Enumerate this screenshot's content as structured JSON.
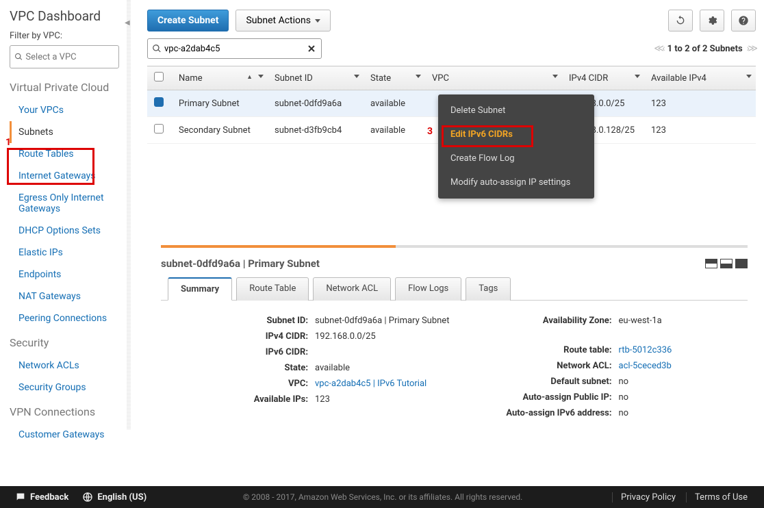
{
  "annotations": {
    "marker1": "1",
    "marker3": "3"
  },
  "sidebar": {
    "title": "VPC Dashboard",
    "filter_label": "Filter by VPC:",
    "filter_placeholder": "Select a VPC",
    "sections": {
      "vpc_title": "Virtual Private Cloud",
      "security_title": "Security",
      "vpn_title": "VPN Connections"
    },
    "items": {
      "your_vpcs": "Your VPCs",
      "subnets": "Subnets",
      "route_tables": "Route Tables",
      "internet_gateways": "Internet Gateways",
      "egress_igw": "Egress Only Internet Gateways",
      "dhcp": "DHCP Options Sets",
      "eips": "Elastic IPs",
      "endpoints": "Endpoints",
      "nat": "NAT Gateways",
      "peering": "Peering Connections",
      "nacls": "Network ACLs",
      "sgs": "Security Groups",
      "cgw": "Customer Gateways"
    }
  },
  "toolbar": {
    "create": "Create Subnet",
    "actions": "Subnet Actions"
  },
  "search": {
    "value": "vpc-a2dab4c5"
  },
  "pager": {
    "text": "1 to 2 of 2 Subnets"
  },
  "columns": {
    "name": "Name",
    "subnet_id": "Subnet ID",
    "state": "State",
    "vpc": "VPC",
    "ipv4_cidr": "IPv4 CIDR",
    "avail_ipv4": "Available IPv4"
  },
  "rows": [
    {
      "selected": true,
      "name": "Primary Subnet",
      "subnet_id": "subnet-0dfd9a6a",
      "state": "available",
      "vpc": "",
      "ipv4_cidr": "92.168.0.0/25",
      "avail": "123"
    },
    {
      "selected": false,
      "name": "Secondary Subnet",
      "subnet_id": "subnet-d3fb9cb4",
      "state": "available",
      "vpc": "",
      "ipv4_cidr": "92.168.0.128/25",
      "avail": "123"
    }
  ],
  "context_menu": {
    "delete": "Delete Subnet",
    "edit_ipv6": "Edit IPv6 CIDRs",
    "flow_log": "Create Flow Log",
    "auto_assign": "Modify auto-assign IP settings"
  },
  "detail": {
    "title": "subnet-0dfd9a6a | Primary Subnet",
    "tabs": {
      "summary": "Summary",
      "route": "Route Table",
      "nacl": "Network ACL",
      "flow": "Flow Logs",
      "tags": "Tags"
    },
    "left": {
      "subnet_id_k": "Subnet ID:",
      "subnet_id_v": "subnet-0dfd9a6a | Primary Subnet",
      "ipv4_k": "IPv4 CIDR:",
      "ipv4_v": "192.168.0.0/25",
      "ipv6_k": "IPv6 CIDR:",
      "ipv6_v": "",
      "state_k": "State:",
      "state_v": "available",
      "vpc_k": "VPC:",
      "vpc_v": "vpc-a2dab4c5 | IPv6 Tutorial",
      "avail_k": "Available IPs:",
      "avail_v": "123"
    },
    "right": {
      "az_k": "Availability Zone:",
      "az_v": "eu-west-1a",
      "rt_k": "Route table:",
      "rt_v": "rtb-5012c336",
      "nacl_k": "Network ACL:",
      "nacl_v": "acl-5ceced3b",
      "default_k": "Default subnet:",
      "default_v": "no",
      "auto4_k": "Auto-assign Public IP:",
      "auto4_v": "no",
      "auto6_k": "Auto-assign IPv6 address:",
      "auto6_v": "no"
    }
  },
  "footer": {
    "feedback": "Feedback",
    "language": "English (US)",
    "copyright": "© 2008 - 2017, Amazon Web Services, Inc. or its affiliates. All rights reserved.",
    "privacy": "Privacy Policy",
    "terms": "Terms of Use"
  }
}
